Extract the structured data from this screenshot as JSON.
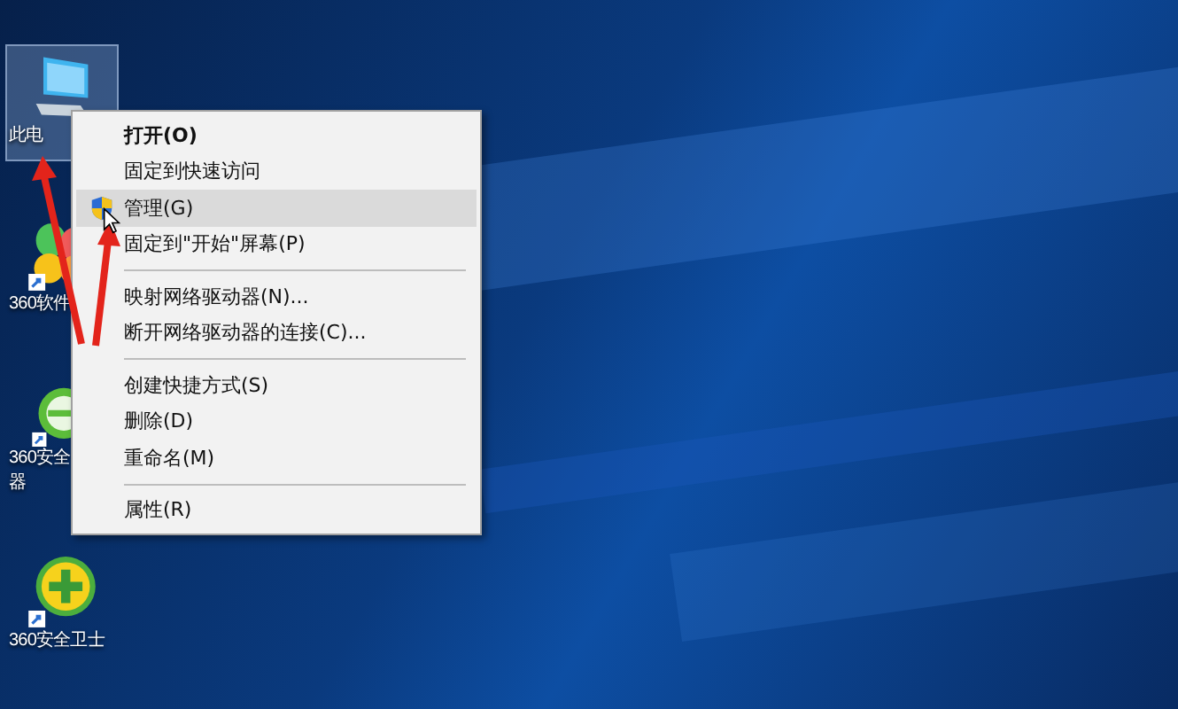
{
  "desktop_icons": [
    {
      "kind": "computer",
      "label_lines": [
        "此电"
      ],
      "selected": true
    },
    {
      "kind": "software",
      "label_lines": [
        "360软件"
      ],
      "selected": false
    },
    {
      "kind": "browser",
      "label_lines": [
        "360安全",
        "器"
      ],
      "selected": false
    },
    {
      "kind": "guard",
      "label_lines": [
        "360安全卫士"
      ],
      "selected": false
    }
  ],
  "context_menu": {
    "items": [
      {
        "kind": "item",
        "label": "打开(O)",
        "default": true,
        "shield": false,
        "selected": false
      },
      {
        "kind": "item",
        "label": "固定到快速访问",
        "default": false,
        "shield": false,
        "selected": false
      },
      {
        "kind": "item",
        "label": "管理(G)",
        "default": false,
        "shield": true,
        "selected": true
      },
      {
        "kind": "item",
        "label": "固定到\"开始\"屏幕(P)",
        "default": false,
        "shield": false,
        "selected": false
      },
      {
        "kind": "separator"
      },
      {
        "kind": "item",
        "label": "映射网络驱动器(N)...",
        "default": false,
        "shield": false,
        "selected": false
      },
      {
        "kind": "item",
        "label": "断开网络驱动器的连接(C)...",
        "default": false,
        "shield": false,
        "selected": false
      },
      {
        "kind": "separator"
      },
      {
        "kind": "item",
        "label": "创建快捷方式(S)",
        "default": false,
        "shield": false,
        "selected": false
      },
      {
        "kind": "item",
        "label": "删除(D)",
        "default": false,
        "shield": false,
        "selected": false
      },
      {
        "kind": "item",
        "label": "重命名(M)",
        "default": false,
        "shield": false,
        "selected": false
      },
      {
        "kind": "separator"
      },
      {
        "kind": "item",
        "label": "属性(R)",
        "default": false,
        "shield": false,
        "selected": false
      }
    ]
  }
}
